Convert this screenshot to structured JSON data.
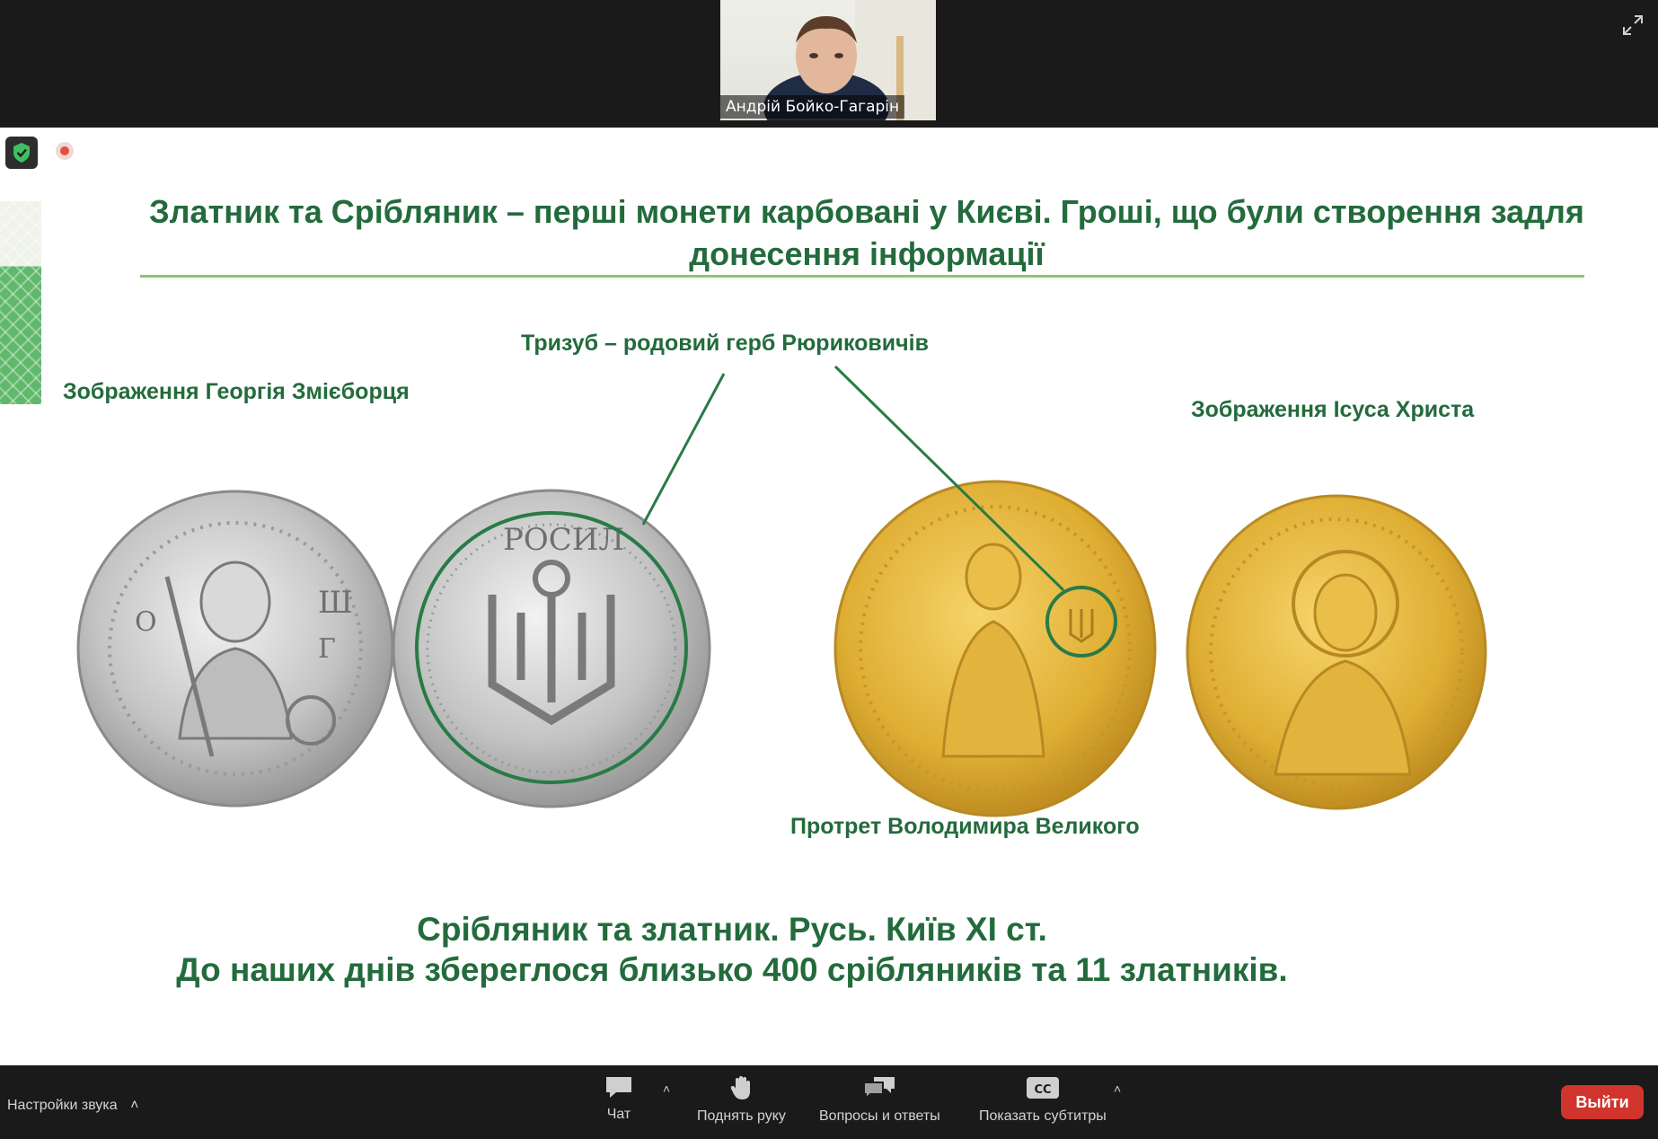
{
  "meeting": {
    "speaker_name": "Андрій Бойко-Гагарін"
  },
  "slide": {
    "title": "Златник та Срібляник – перші монети карбовані у Києві. Гроші, що були створення задля донесення інформації",
    "labels": {
      "georgiy": "Зображення Георгія Змієборця",
      "tryzub": "Тризуб – родовий герб Рюриковичів",
      "jesus": "Зображення Ісуса Христа",
      "volodymyr": "Протрет Володимира Великого"
    },
    "caption_line1": "Срібляник та златник. Русь. Київ ХІ ст.",
    "caption_line2": "До наших днів збереглося близько 400 срібляників та 11 златників.",
    "colors": {
      "title_green": "#236b3c",
      "rule_green": "#8cc673",
      "silver": "#c8c8c8",
      "gold": "#e0b23a"
    }
  },
  "toolbar": {
    "audio_settings": "Настройки звука",
    "chat": "Чат",
    "raise_hand": "Поднять руку",
    "qa": "Вопросы и ответы",
    "captions": "Показать субтитры",
    "captions_badge": "CC",
    "leave": "Выйти",
    "icons": [
      "chat-icon",
      "hand-icon",
      "qa-icon",
      "cc-icon",
      "shield-icon",
      "fullscreen-icon"
    ]
  }
}
